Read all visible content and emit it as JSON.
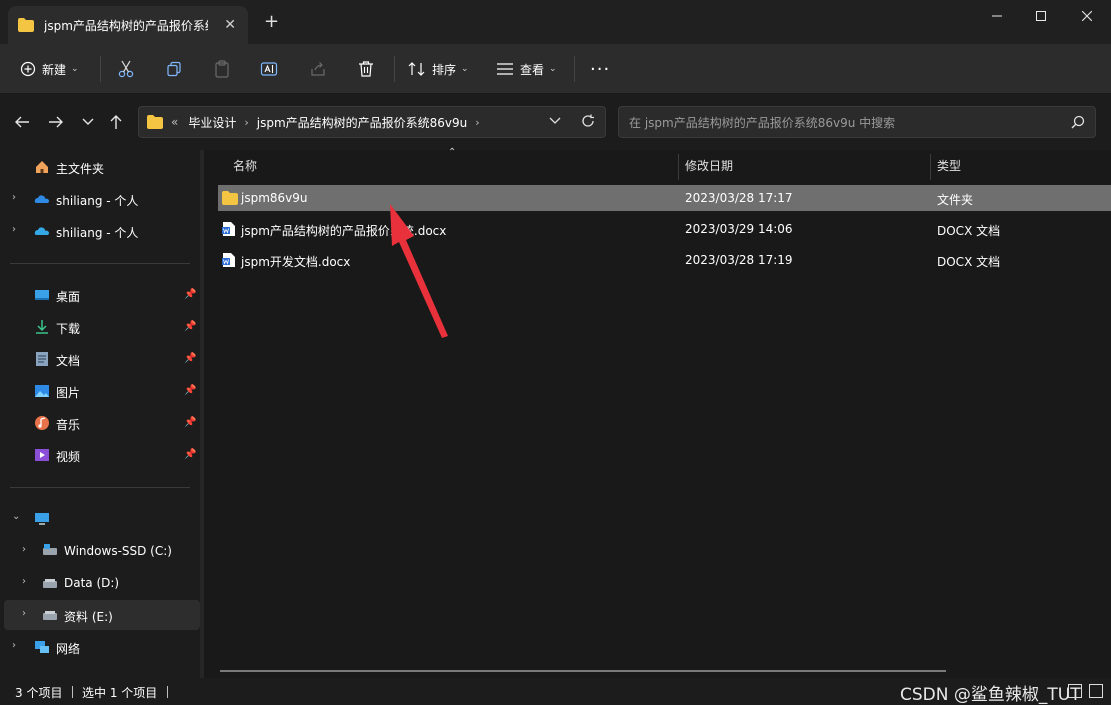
{
  "window": {
    "tab_title": "jspm产品结构树的产品报价系统",
    "tab_close": "✕",
    "new_tab": "+"
  },
  "toolbar": {
    "new_label": "新建",
    "sort_label": "排序",
    "view_label": "查看",
    "more": "···"
  },
  "address": {
    "overflow": "«",
    "crumbs": [
      "毕业设计",
      "jspm产品结构树的产品报价系统86v9u"
    ],
    "search_placeholder": "在 jspm产品结构树的产品报价系统86v9u 中搜索"
  },
  "sidebar": {
    "home": "主文件夹",
    "cloud1": "shiliang - 个人",
    "cloud2": "shiliang - 个人",
    "quick": [
      "桌面",
      "下载",
      "文档",
      "图片",
      "音乐",
      "视频"
    ],
    "drives": [
      "Windows-SSD (C:)",
      "Data (D:)",
      "资料 (E:)"
    ],
    "network": "网络"
  },
  "columns": {
    "name": "名称",
    "modified": "修改日期",
    "type": "类型"
  },
  "files": [
    {
      "name": "jspm86v9u",
      "modified": "2023/03/28 17:17",
      "type": "文件夹",
      "kind": "folder",
      "selected": true
    },
    {
      "name": "jspm产品结构树的产品报价系统.docx",
      "modified": "2023/03/29 14:06",
      "type": "DOCX 文档",
      "kind": "docx",
      "selected": false
    },
    {
      "name": "jspm开发文档.docx",
      "modified": "2023/03/28 17:19",
      "type": "DOCX 文档",
      "kind": "docx",
      "selected": false
    }
  ],
  "status": {
    "count": "3 个项目",
    "selected": "选中 1 个项目",
    "watermark": "CSDN @鲨鱼辣椒_TUT"
  },
  "colors": {
    "folder": "#f4c543",
    "annotation_arrow": "#e8313a",
    "selected_row": "#6f6f6f"
  }
}
